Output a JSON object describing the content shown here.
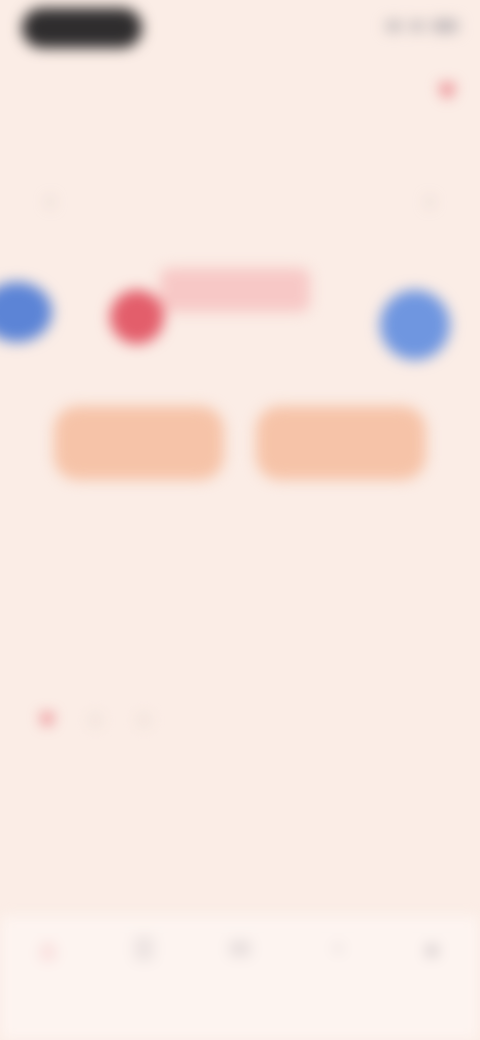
{
  "status_bar": {
    "time": ""
  },
  "header": {
    "title": "",
    "subtitle": "",
    "favorite_icon": "heart-icon"
  },
  "nav": {
    "prev_icon": "chevron-left-icon",
    "next_icon": "chevron-right-icon"
  },
  "illustration": {
    "small_label": "",
    "card_text": ""
  },
  "actions": {
    "left_label": "",
    "right_label": ""
  },
  "content": {
    "title": "",
    "subtitle": "",
    "description": "",
    "section_heading": "",
    "paragraph": ""
  },
  "rating": {
    "icons": [
      "heart-icon",
      "circle-icon",
      "circle-icon"
    ]
  },
  "tabs": [
    {
      "icon": "home-icon",
      "label": ""
    },
    {
      "icon": "list-icon",
      "label": ""
    },
    {
      "icon": "chat-icon",
      "label": ""
    },
    {
      "icon": "bell-icon",
      "label": ""
    },
    {
      "icon": "profile-icon",
      "label": ""
    }
  ],
  "colors": {
    "background": "#fbede6",
    "accent": "#e35e6b",
    "button": "#f6c3a8"
  }
}
